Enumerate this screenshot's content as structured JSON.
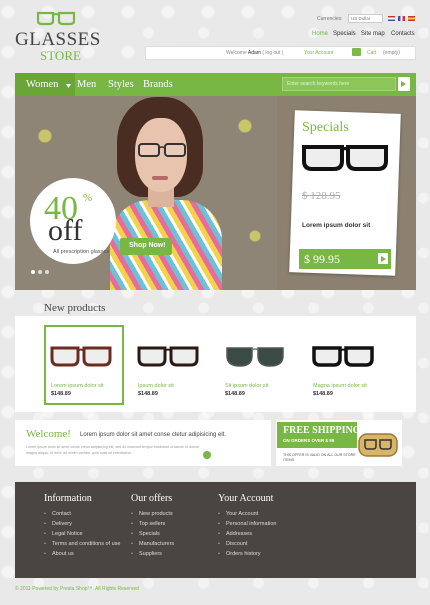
{
  "logo": {
    "title": "GLASSES",
    "subtitle": "STORE"
  },
  "header": {
    "currencies_label": "Currencies:",
    "currency_value": "US Dollar",
    "nav": [
      {
        "label": "Home",
        "active": true
      },
      {
        "label": "Specials"
      },
      {
        "label": "Site map"
      },
      {
        "label": "Contacts"
      }
    ],
    "welcome_prefix": "Welcome",
    "user": "Adam",
    "logout": "( log out )",
    "account": "Your Account",
    "cart": "Cart",
    "cart_status": "(empty)"
  },
  "menu": {
    "items": [
      "Women",
      "Men",
      "Styles",
      "Brands"
    ],
    "search_placeholder": "Enter search keywords here"
  },
  "banner": {
    "big": "40",
    "percent": "%",
    "off": "off",
    "subtitle": "All prescription glasses",
    "button": "Shop Now!"
  },
  "specials": {
    "title": "Specials",
    "old_price": "$ 128.95",
    "name": "Lorem ipsum dolor sit",
    "new_price": "$ 99.95"
  },
  "new_products": {
    "title": "New products",
    "items": [
      {
        "name": "Lorem ipsum dolor sit",
        "price": "$148.89"
      },
      {
        "name": "Ipsum dolor sit",
        "price": "$148.89"
      },
      {
        "name": "Sit ipsum dolor sit",
        "price": "$148.89"
      },
      {
        "name": "Magna ipsum dolor sit",
        "price": "$148.89"
      }
    ]
  },
  "welcome_block": {
    "title": "Welcome!",
    "headline": "Lorem ipsum dolor sit amet conse ctetur adipisicing elt.",
    "text": "Lorem ipsum dolor sit amet conse ctetur adipisicing elit, sed do eiusmod tempor incididunt ut labore et dolore magna aliqua. Ut enim ad minim veniam, quis nostrud exercitation"
  },
  "shipping": {
    "title": "FREE SHIPPING",
    "subtitle": "ON ORDERS OVER $ 99",
    "note": "THIS OFFER IS VALID ON ALL OUR STORE ITEMS"
  },
  "footer": {
    "information": {
      "title": "Information",
      "links": [
        "Contact",
        "Delivery",
        "Legal Notice",
        "Terms and conditions of use",
        "About us"
      ]
    },
    "offers": {
      "title": "Our offers",
      "links": [
        "New products",
        "Top sellers",
        "Specials",
        "Manufacturers",
        "Suppliers"
      ]
    },
    "account": {
      "title": "Your Account",
      "links": [
        "Your Account",
        "Personal information",
        "Addresses",
        "Discount",
        "Orders history"
      ]
    },
    "copyright": "© 2011 Powered by Presta Shop™. All Rights Reserved"
  }
}
